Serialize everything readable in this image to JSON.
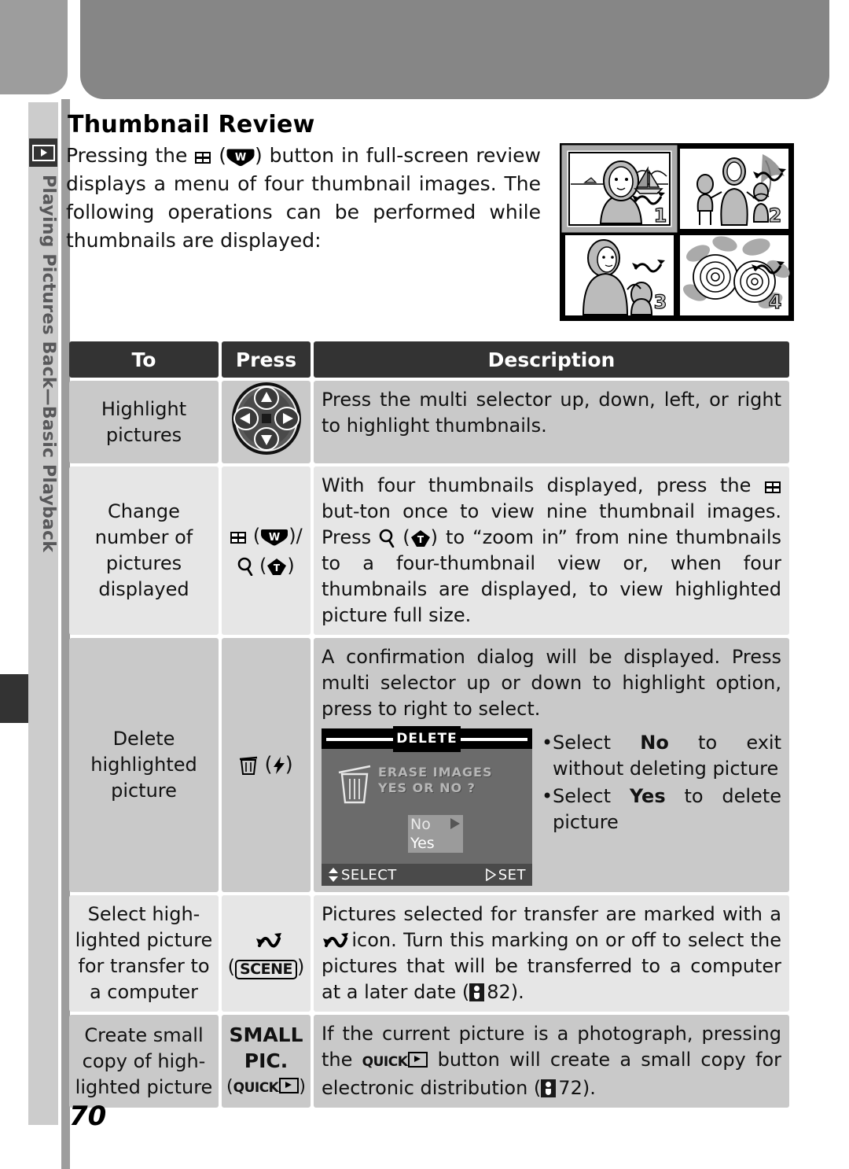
{
  "document": {
    "page_number": "70",
    "chapter_label": "Playing Pictures Back—Basic Playback",
    "chapter_icon": "playback-icon",
    "section_title": "Thumbnail Review"
  },
  "intro": {
    "line1_a": "Pressing the",
    "line1_b": "(",
    "line1_c": ") button in full-screen review",
    "rest": "displays a menu of four thumbnail images.  The following operations can be performed while thumbnails are displayed:"
  },
  "illustration": {
    "name": "four-thumbnail-review-illustration",
    "thumbnails": [
      {
        "number": "1",
        "subject": "woman-with-sailboat",
        "selected": true,
        "transfer_marked": true
      },
      {
        "number": "2",
        "subject": "woman-with-two-children",
        "selected": false,
        "transfer_marked": true
      },
      {
        "number": "3",
        "subject": "woman-with-child",
        "selected": false,
        "transfer_marked": true
      },
      {
        "number": "4",
        "subject": "flowers",
        "selected": false,
        "transfer_marked": true
      }
    ]
  },
  "table": {
    "headers": {
      "to": "To",
      "press": "Press",
      "description": "Description"
    },
    "rows": [
      {
        "id": "highlight-pictures",
        "to": "Highlight\npictures",
        "press_icon": "multi-selector-icon",
        "press_label": "",
        "description": "Press the multi selector up, down, left, or right to highlight thumbnails."
      },
      {
        "id": "change-number-of-pictures",
        "to": "Change\nnumber of\npictures\ndisplayed",
        "press_icon": "thumbnail-button-w-and-zoom-button-t",
        "press_label": "",
        "description_part1": "With four thumbnails displayed, press the",
        "description_part2": "but-ton once to view nine thumbnail images.  Press",
        "description_part3": "(",
        "description_part4": ") to “zoom in” from nine thumbnails to a four-thumbnail view or, when four thumbnails are displayed, to view highlighted picture full size."
      },
      {
        "id": "delete-highlighted-picture",
        "to": "Delete\nhighlighted\npicture",
        "press_icon": "delete-button-flash-icon",
        "press_label": "",
        "description": "A confirmation dialog will be displayed.  Press multi selector up or down to highlight option, press to right to select.",
        "bullets": [
          {
            "pre": "Select ",
            "bold": "No",
            "post": " to exit without deleting picture"
          },
          {
            "pre": "Select ",
            "bold": "Yes",
            "post": " to delete picture"
          }
        ],
        "lcd": {
          "title": "DELETE",
          "message_line1": "ERASE IMAGES",
          "message_line2": "YES OR NO  ?",
          "icon": "trash-icon",
          "options": [
            {
              "label": "No",
              "highlighted": false,
              "arrow": true
            },
            {
              "label": "Yes",
              "highlighted": true,
              "arrow": false
            }
          ],
          "footer_left": "SELECT",
          "footer_right": "SET"
        }
      },
      {
        "id": "select-for-transfer",
        "to": "Select high-\nlighted picture\nfor transfer to\na computer",
        "press_icon": "transfer-mark-icon",
        "press_label": "SCENE",
        "description_part1": "Pictures selected for transfer are marked with a",
        "description_part2": "icon.  Turn this marking on or off to select the pictures that will be transferred to a computer at a later date (",
        "description_ref": "82",
        "description_part3": ")."
      },
      {
        "id": "create-small-copy",
        "to": "Create small\ncopy of high-\nlighted picture",
        "press_label_line1": "SMALL",
        "press_label_line2": "PIC.",
        "press_label_line3": "QUICK",
        "description_part1": "If the current picture is a photograph, pressing the",
        "description_part2": "button will create a small copy for electronic distribution (",
        "description_ref": "72",
        "description_part3": ")."
      }
    ]
  },
  "colors": {
    "header_band": "#868686",
    "side_strip": "#cccccc",
    "table_header": "#333333",
    "row_shade_dark": "#c9c9c9",
    "row_shade_light": "#e6e6e6",
    "lcd_background": "#6b6b6b"
  }
}
